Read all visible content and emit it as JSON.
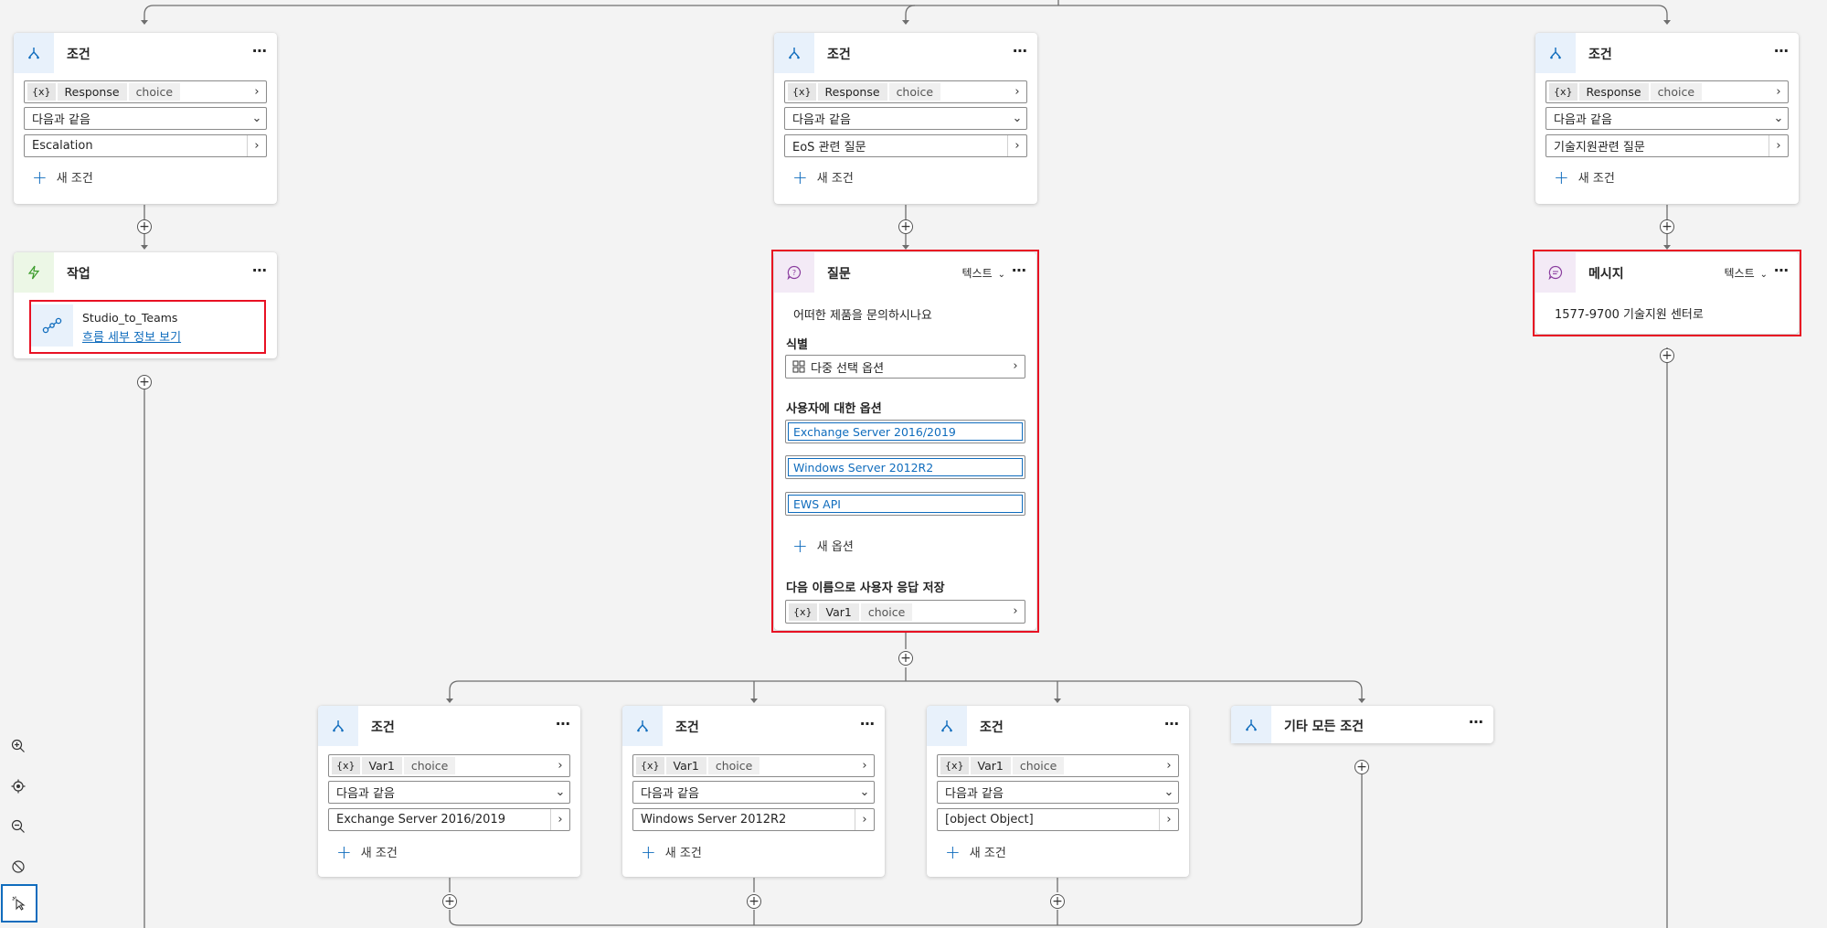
{
  "icons": {
    "condition": "branch-icon",
    "action": "flash-icon",
    "question": "question-bubble-icon",
    "message": "chat-bubble-icon",
    "flow": "flow-icon",
    "multi_select": "grid-options-icon"
  },
  "colors": {
    "accent": "#0f6cbd",
    "selection": "#e81123",
    "canvas": "#f3f3f3",
    "connector": "#6e6e6e"
  },
  "common": {
    "more": "⋯",
    "var_x": "{x}",
    "add_condition": "새 조건",
    "operator_equals": "다음과 같음",
    "type_text": "텍스트",
    "var_type_choice": "choice"
  },
  "top_conditions": [
    {
      "title": "조건",
      "variable": "Response",
      "value": "Escalation"
    },
    {
      "title": "조건",
      "variable": "Response",
      "value": "EoS 관련 질문"
    },
    {
      "title": "조건",
      "variable": "Response",
      "value": "기술지원관련 질문"
    }
  ],
  "action_node": {
    "title": "작업",
    "flow_name": "Studio_to_Teams",
    "flow_link": "흐름 세부 정보 보기"
  },
  "question_node": {
    "title": "질문",
    "prompt": "어떠한 제품을 문의하시나요",
    "identify_label": "식별",
    "identify_value": "다중 선택 옵션",
    "options_label": "사용자에 대한 옵션",
    "options": [
      "Exchange Server 2016/2019",
      "Windows Server 2012R2",
      "EWS API"
    ],
    "add_option": "새 옵션",
    "save_label": "다음 이름으로 사용자 응답 저장",
    "save_variable": "Var1"
  },
  "message_node": {
    "title": "메시지",
    "text": "1577-9700 기술지원 센터로"
  },
  "bottom_conditions": [
    {
      "title": "조건",
      "variable": "Var1",
      "value": "Exchange Server 2016/2019"
    },
    {
      "title": "조건",
      "variable": "Var1",
      "value": "Windows Server 2012R2"
    },
    {
      "title": "조건",
      "variable": "Var1",
      "value": "[object Object]"
    }
  ],
  "other_conditions": {
    "title": "기타 모든 조건"
  },
  "zoom_toolbar": [
    "zoom-in-icon",
    "recenter-icon",
    "zoom-out-icon",
    "reset-icon",
    "select-mode-icon"
  ]
}
